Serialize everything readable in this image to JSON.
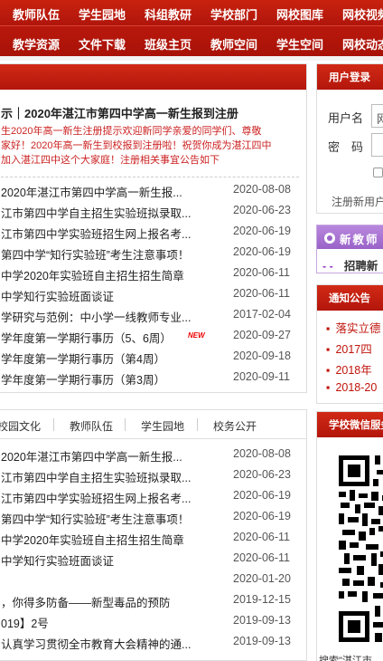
{
  "nav_row1": [
    {
      "label": "教师队伍"
    },
    {
      "label": "学生园地"
    },
    {
      "label": "科组教研"
    },
    {
      "label": "学校部门"
    },
    {
      "label": "网校图库"
    },
    {
      "label": "网校视频"
    }
  ],
  "nav_row2": [
    {
      "label": "教学资源"
    },
    {
      "label": "文件下载"
    },
    {
      "label": "班级主页"
    },
    {
      "label": "教师空间"
    },
    {
      "label": "学生空间"
    },
    {
      "label": "网校动态"
    }
  ],
  "featured": {
    "headline": "示｜2020年湛江市第四中学高一新生报到注册",
    "summary_lines": [
      "生2020年高一新生注册提示欢迎新同学亲爱的同学们、尊敬",
      "家好！2020年高一新生到校报到注册啦！祝贺你成为湛江四中",
      "加入湛江四中这个大家庭！注册相关事宜公告如下"
    ]
  },
  "news_list": [
    {
      "title": "2020年湛江市第四中学高一新生报...",
      "date": "2020-08-08"
    },
    {
      "title": "江市第四中学自主招生实验班拟录取...",
      "date": "2020-06-23"
    },
    {
      "title": "江市第四中学实验班招生网上报名考...",
      "date": "2020-06-19"
    },
    {
      "title": "第四中学“知行实验班”考生注意事项！",
      "date": "2020-06-19"
    },
    {
      "title": "中学2020年实验班自主招生招生简章",
      "date": "2020-06-11"
    },
    {
      "title": "中学知行实验班面谈证",
      "date": "2020-06-11"
    },
    {
      "title": "学研究与范例：中小学一线教师专业...",
      "date": "2017-02-04"
    },
    {
      "title": "学年度第一学期行事历（5、6周）",
      "date": "2020-09-27",
      "badge": "NEW"
    },
    {
      "title": "学年度第一学期行事历（第4周）",
      "date": "2020-09-18"
    },
    {
      "title": "学年度第一学期行事历（第3周）",
      "date": "2020-09-11"
    }
  ],
  "tabs": [
    {
      "label": "校园文化"
    },
    {
      "label": "教师队伍"
    },
    {
      "label": "学生园地"
    },
    {
      "label": "校务公开"
    }
  ],
  "tab_news": [
    {
      "title": "2020年湛江市第四中学高一新生报...",
      "date": "2020-08-08"
    },
    {
      "title": "江市第四中学自主招生实验班拟录取...",
      "date": "2020-06-23"
    },
    {
      "title": "江市第四中学实验班招生网上报名考...",
      "date": "2020-06-19"
    },
    {
      "title": "第四中学“知行实验班”考生注意事项！",
      "date": "2020-06-19"
    },
    {
      "title": "中学2020年实验班自主招生招生简章",
      "date": "2020-06-11"
    },
    {
      "title": "中学知行实验班面谈证",
      "date": "2020-06-11"
    },
    {
      "title": "",
      "date": "2020-01-20"
    },
    {
      "title": "，你得多防备——新型毒品的预防",
      "date": "2019-12-15"
    },
    {
      "title": "019】2号",
      "date": "2019-09-13"
    },
    {
      "title": "认真学习贯彻全市教育大会精神的通...",
      "date": "2019-09-13"
    }
  ],
  "login": {
    "title": "用户登录",
    "username_label": "用户名",
    "username_value": "网",
    "password_label": "密　码",
    "register_text": "注册新用户"
  },
  "teacher": {
    "title": "新教师",
    "dash": "- -",
    "line": "招聘新"
  },
  "notice": {
    "title": "通知公告",
    "bullet": "▪",
    "items": [
      {
        "text": "落实立德"
      },
      {
        "text": "2017四"
      },
      {
        "text": "2018年"
      },
      {
        "text": "2018-20"
      }
    ]
  },
  "wechat": {
    "title": "学校微信服务",
    "caption": "搜索\"湛江市"
  },
  "colors": {
    "primary_red": "#c01a10",
    "notice_red": "#c0150c",
    "teacher_purple": "#9a62c8"
  }
}
